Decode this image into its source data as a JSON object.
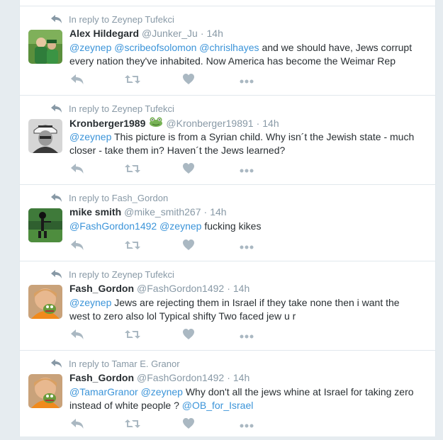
{
  "colors": {
    "link": "#3b94d9",
    "muted": "#8899a6",
    "text": "#292f33",
    "action_icon": "#aab8c2",
    "border": "#e1e8ed",
    "background": "#e6ecf0"
  },
  "icons": {
    "reply": "reply-icon",
    "retweet": "retweet-icon",
    "like": "heart-icon",
    "more": "more-icon",
    "badge": "frog-emoji-icon"
  },
  "tweets": [
    {
      "context": "In reply to Zeynep Tufekci",
      "fullname": "Alex Hildegard",
      "username": "@Junker_Ju",
      "separator": "·",
      "time": "14h",
      "line1": {
        "m1": "@zeynep",
        "m2": "@scribeofsolomon",
        "m3": "@chrislhayes",
        "rest": "and we should have, Jews corrupt"
      },
      "line2": "every nation they've inhabited. Now America has become the Weimar Rep"
    },
    {
      "context": "In reply to Zeynep Tufekci",
      "fullname": "Kronberger1989",
      "username": "@Kronberger19891",
      "separator": "·",
      "time": "14h",
      "line1": {
        "m1": "@zeynep",
        "rest": "This picture is from a Syrian child. Why isn´t the Jewish state - much"
      },
      "line2": "closer - take them in? Haven´t the Jews learned?"
    },
    {
      "context": "In reply to Fash_Gordon",
      "fullname": "mike smith",
      "username": "@mike_smith267",
      "separator": "·",
      "time": "14h",
      "line1": {
        "m1": "@FashGordon1492",
        "m2": "@zeynep",
        "rest": "fucking kikes"
      }
    },
    {
      "context": "In reply to Zeynep Tufekci",
      "fullname": "Fash_Gordon",
      "username": "@FashGordon1492",
      "separator": "·",
      "time": "14h",
      "line1": {
        "m1": "@zeynep",
        "rest": "Jews are rejecting them in Israel if they take none then i want the"
      },
      "line2": "west to zero also lol Typical shifty Two faced jew u r"
    },
    {
      "context": "In reply to Tamar E. Granor",
      "fullname": "Fash_Gordon",
      "username": "@FashGordon1492",
      "separator": "·",
      "time": "14h",
      "line1": {
        "m1": "@TamarGranor",
        "m2": "@zeynep",
        "rest": "Why don't all the jews whine at Israel for taking zero"
      },
      "line2": {
        "text": "instead of white people ?",
        "m1": "@OB_for_Israel"
      }
    }
  ]
}
